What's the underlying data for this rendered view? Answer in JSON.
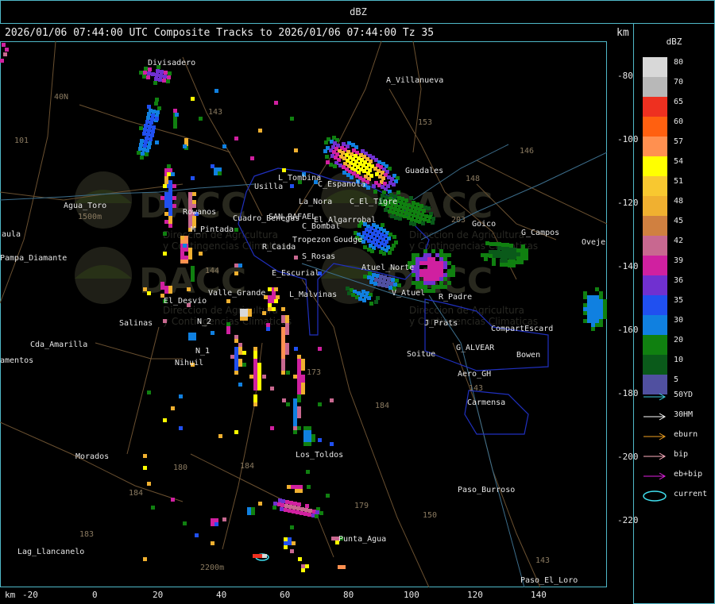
{
  "window_title": "dBZ",
  "header": {
    "text": "2026/01/06 07:44:00 UTC Composite Tracks to 2026/01/06 07:44:00 Tz 35",
    "units": "km"
  },
  "legend": {
    "title": "dBZ",
    "scale": [
      {
        "label": "80",
        "color": "#d8d8d8"
      },
      {
        "label": "70",
        "color": "#b8b8b8"
      },
      {
        "label": "65",
        "color": "#ee3020"
      },
      {
        "label": "60",
        "color": "#ff6010"
      },
      {
        "label": "57",
        "color": "#ff9050"
      },
      {
        "label": "54",
        "color": "#ffff00"
      },
      {
        "label": "51",
        "color": "#f8c830"
      },
      {
        "label": "48",
        "color": "#f0b030"
      },
      {
        "label": "45",
        "color": "#d08040"
      },
      {
        "label": "42",
        "color": "#c86890"
      },
      {
        "label": "39",
        "color": "#d020a0"
      },
      {
        "label": "36",
        "color": "#7030d0"
      },
      {
        "label": "35",
        "color": "#2050f0"
      },
      {
        "label": "30",
        "color": "#1080e0"
      },
      {
        "label": "20",
        "color": "#108010"
      },
      {
        "label": "10",
        "color": "#0a5a1a"
      },
      {
        "label": "5",
        "color": "#5050a0"
      }
    ],
    "tracks": [
      {
        "label": "50YD",
        "color": "#40d0e0",
        "kind": "arrow"
      },
      {
        "label": "30HM",
        "color": "#ffffff",
        "kind": "arrow"
      },
      {
        "label": "eburn",
        "color": "#f0a020",
        "kind": "arrow"
      },
      {
        "label": "bip",
        "color": "#ffb0c0",
        "kind": "arrow"
      },
      {
        "label": "eb+bip",
        "color": "#e020e0",
        "kind": "arrow"
      },
      {
        "label": "current",
        "color": "#40e0f0",
        "kind": "ellipse"
      }
    ]
  },
  "axes": {
    "x_unit": "km",
    "x_ticks": [
      "-20",
      "0",
      "20",
      "40",
      "60",
      "80",
      "100",
      "120",
      "140"
    ],
    "y_ticks": [
      "-80",
      "-100",
      "-120",
      "-140",
      "-160",
      "-180",
      "-200",
      "-220"
    ]
  },
  "map": {
    "places": [
      "Divisadero",
      "A_Villanueva",
      "40N",
      "101",
      "Agua_Toro",
      "1500m",
      "aula",
      "Pampa_Diamante",
      "El_Desvio",
      "Salinas",
      "Cda_Amarilla",
      "amentos",
      "N_1",
      "Nihuil",
      "N_2",
      "Morados",
      "Lag_Llancanelo",
      "Rowanos",
      "M_Pintada",
      "Valle_Grande",
      "E_Escurial",
      "L_Malvinas",
      "R_Caida",
      "S_Rosas",
      "Cuadro_Benegas",
      "SAN_RAFAEL",
      "C_Bombal",
      "Tropezon",
      "Goudge",
      "L_Tombina",
      "Usilla",
      "La_Nora",
      "C_Espanola",
      "C_El_Tigre",
      "El_Algarrobal",
      "Guadales",
      "Goico",
      "G_Campos",
      "Oveje",
      "Atuel_Norte",
      "V_Atuel",
      "R_Padre",
      "J_Prats",
      "CompartEscard",
      "G_ALVEAR",
      "Bowen",
      "Soitue",
      "Aero_GH",
      "Carmensa",
      "Los_Toldos",
      "Punta_Agua",
      "Paso_Burroso",
      "Paso_El_Loro",
      "2200m"
    ],
    "route_numbers": [
      "143",
      "153",
      "146",
      "148",
      "203",
      "144",
      "173",
      "184",
      "180",
      "179",
      "150",
      "143",
      "184",
      "183",
      "184",
      "143"
    ],
    "watermark": {
      "org": "DACC",
      "lines": [
        "Direccion de Agricultura",
        "y Contingencias Climaticas"
      ]
    }
  }
}
